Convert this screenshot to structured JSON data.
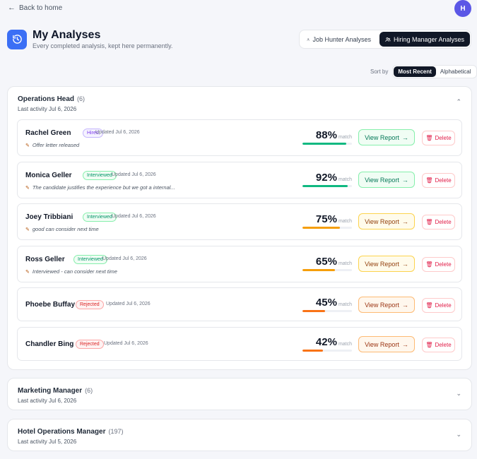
{
  "nav": {
    "back_label": "Back to home"
  },
  "user": {
    "avatar_initial": "H"
  },
  "header": {
    "title": "My Analyses",
    "subtitle": "Every completed analysis, kept here permanently."
  },
  "tabs": [
    {
      "label": "Job Hunter Analyses",
      "icon": "user-icon",
      "active": false
    },
    {
      "label": "Hiring Manager Analyses",
      "icon": "users-icon",
      "active": true
    }
  ],
  "sort": {
    "label": "Sort by",
    "options": [
      "Most Recent",
      "Alphabetical"
    ],
    "selected": "Most Recent"
  },
  "groups": [
    {
      "title": "Operations Head",
      "count": "(6)",
      "last_activity": "Last activity Jul 6, 2026",
      "expanded": true
    },
    {
      "title": "Marketing Manager",
      "count": "(6)",
      "last_activity": "Last activity Jul 6, 2026",
      "expanded": false
    },
    {
      "title": "Hotel Operations Manager",
      "count": "(197)",
      "last_activity": "Last activity Jul 5, 2026",
      "expanded": false
    }
  ],
  "candidates": [
    {
      "name": "Rachel Green",
      "status": "Hired",
      "updated": "Updated Jul 6, 2026",
      "note": "Offer letter released",
      "score": "88%",
      "score_value": 88,
      "match_label": "match",
      "view_label": "View Report",
      "delete_label": "Delete"
    },
    {
      "name": "Monica Geller",
      "status": "Interviewed",
      "updated": "Updated Jul 6, 2026",
      "note": "The candidate justifies the experience but we got a internal...",
      "score": "92%",
      "score_value": 92,
      "match_label": "match",
      "view_label": "View Report",
      "delete_label": "Delete"
    },
    {
      "name": "Joey Tribbiani",
      "status": "Interviewed",
      "updated": "Updated Jul 6, 2026",
      "note": "good can consider next time",
      "score": "75%",
      "score_value": 75,
      "match_label": "match",
      "view_label": "View Report",
      "delete_label": "Delete"
    },
    {
      "name": "Ross Geller",
      "status": "Interviewed",
      "updated": "Updated Jul 6, 2026",
      "note": "Interviewed - can consider next time",
      "score": "65%",
      "score_value": 65,
      "match_label": "match",
      "view_label": "View Report",
      "delete_label": "Delete"
    },
    {
      "name": "Phoebe Buffay",
      "status": "Rejected",
      "updated": "Updated Jul 6, 2026",
      "note": "",
      "score": "45%",
      "score_value": 45,
      "match_label": "match",
      "view_label": "View Report",
      "delete_label": "Delete"
    },
    {
      "name": "Chandler Bing",
      "status": "Rejected",
      "updated": "Updated Jul 6, 2026",
      "note": "",
      "score": "42%",
      "score_value": 42,
      "match_label": "match",
      "view_label": "View Report",
      "delete_label": "Delete"
    }
  ],
  "colors": {
    "accent": "#3b6ff5",
    "avatar": "#5b57e6",
    "score_high": "#10b981",
    "score_mid": "#f59e0b",
    "score_low": "#f97316",
    "delete": "#e11d48"
  }
}
